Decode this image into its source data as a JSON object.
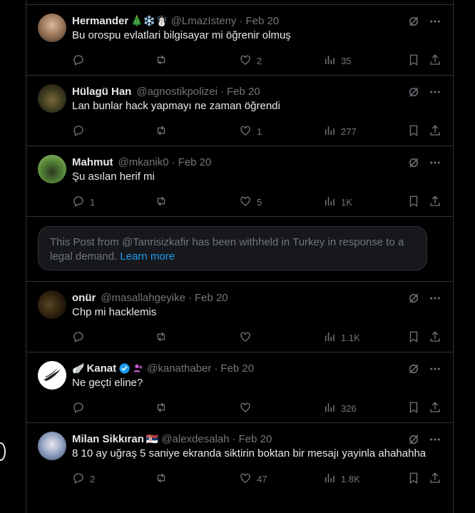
{
  "posts": [
    {
      "name": "Hermander",
      "emojis": "🎄❄️☃️",
      "verified": false,
      "handle": "@LmazIsteny",
      "date": "Feb 20",
      "text": "Bu orospu evlatlari bilgisayar mi öğrenir olmuş",
      "replies": "",
      "retweets": "",
      "likes": "2",
      "views": "35",
      "avatar_colors": [
        "#c9a98a",
        "#6d4c3a"
      ]
    },
    {
      "name": "Hülagü Han",
      "emojis": "",
      "verified": false,
      "handle": "@agnostikpolizei",
      "date": "Feb 20",
      "text": "Lan bunlar hack yapmayı ne zaman öğrendi",
      "replies": "",
      "retweets": "",
      "likes": "1",
      "views": "277",
      "avatar_colors": [
        "#4a4a2a",
        "#1e1e10"
      ]
    },
    {
      "name": "Mahmut",
      "emojis": "",
      "verified": false,
      "handle": "@mkanik0",
      "date": "Feb 20",
      "text": "Şu asılan herif mi",
      "replies": "1",
      "retweets": "",
      "likes": "5",
      "views": "1K",
      "avatar_colors": [
        "#7fae5a",
        "#1f2a16"
      ]
    },
    {
      "name": "onür",
      "emojis": "",
      "verified": false,
      "handle": "@masallahgeyike",
      "date": "Feb 20",
      "text": "Chp mi hacklemis",
      "replies": "",
      "retweets": "",
      "likes": "",
      "views": "1.1K",
      "avatar_colors": [
        "#3a2a14",
        "#120c05"
      ]
    },
    {
      "name": "Kanat",
      "emojis": "🪽",
      "verified": true,
      "handle": "@kanathaber",
      "date": "Feb 20",
      "text": "Ne geçti eline?",
      "replies": "",
      "retweets": "",
      "likes": "",
      "views": "326",
      "avatar_colors": [
        "#ffffff",
        "#cfcfcf"
      ]
    },
    {
      "name": "Milan Sikkıran",
      "emojis": "🇷🇸",
      "verified": false,
      "handle": "@alexdesalah",
      "date": "Feb 20",
      "text": "8 10 ay uğraş 5 saniye ekranda siktirin boktan bir mesajı yayinla ahahahha",
      "replies": "2",
      "retweets": "",
      "likes": "47",
      "views": "1.8K",
      "avatar_colors": [
        "#8fa3c8",
        "#3a4a6a"
      ]
    }
  ],
  "withheld": {
    "text": "This Post from @Tanrisizkafir has been withheld in Turkey in response to a legal demand.",
    "link": "Learn more"
  },
  "colors": {
    "background": "#000000",
    "text": "#e7e9ea",
    "muted": "#71767b",
    "link": "#1d9bf0",
    "border": "#2f3336",
    "verified": "#1d9bf0"
  },
  "icons": [
    "grok-icon",
    "more-icon",
    "reply-icon",
    "retweet-icon",
    "like-icon",
    "views-icon",
    "bookmark-icon",
    "share-icon",
    "verified-badge-icon"
  ]
}
